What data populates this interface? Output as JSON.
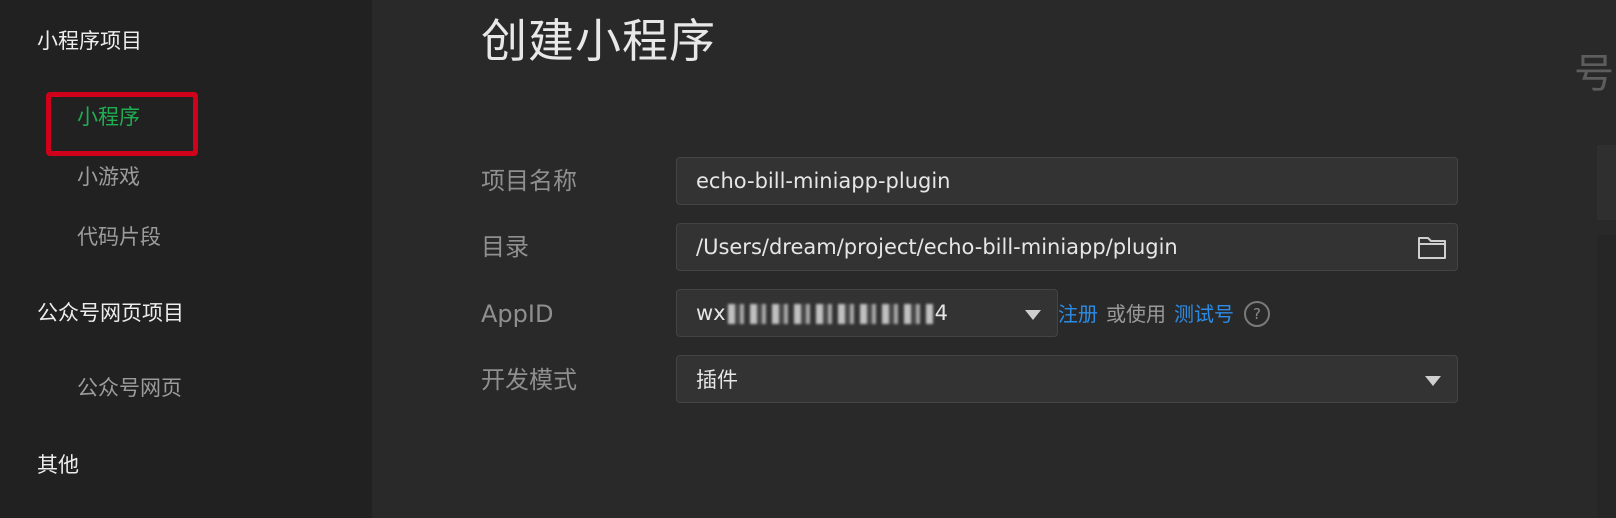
{
  "sidebar": {
    "sections": [
      {
        "title": "小程序项目",
        "items": [
          "小程序",
          "小游戏",
          "代码片段"
        ]
      },
      {
        "title": "公众号网页项目",
        "items": [
          "公众号网页"
        ]
      },
      {
        "title": "其他",
        "items": []
      }
    ],
    "active_item": "小程序"
  },
  "main": {
    "title": "创建小程序",
    "form": {
      "project_name": {
        "label": "项目名称",
        "value": "echo-bill-miniapp-plugin"
      },
      "directory": {
        "label": "目录",
        "value": "/Users/dream/project/echo-bill-miniapp/plugin"
      },
      "appid": {
        "label": "AppID",
        "value_prefix": "wx",
        "value_suffix": "4",
        "register_link": "注册",
        "or_use": "或使用",
        "test_account_link": "测试号",
        "help": "?"
      },
      "dev_mode": {
        "label": "开发模式",
        "value": "插件"
      }
    },
    "edge_text": "号"
  },
  "colors": {
    "accent_green": "#1fad52",
    "link_blue": "#2c8ce5",
    "highlight_red": "#d0021b"
  },
  "icons": {
    "folder": "folder-icon",
    "dropdown": "chevron-down-icon",
    "help": "help-circle-icon"
  }
}
